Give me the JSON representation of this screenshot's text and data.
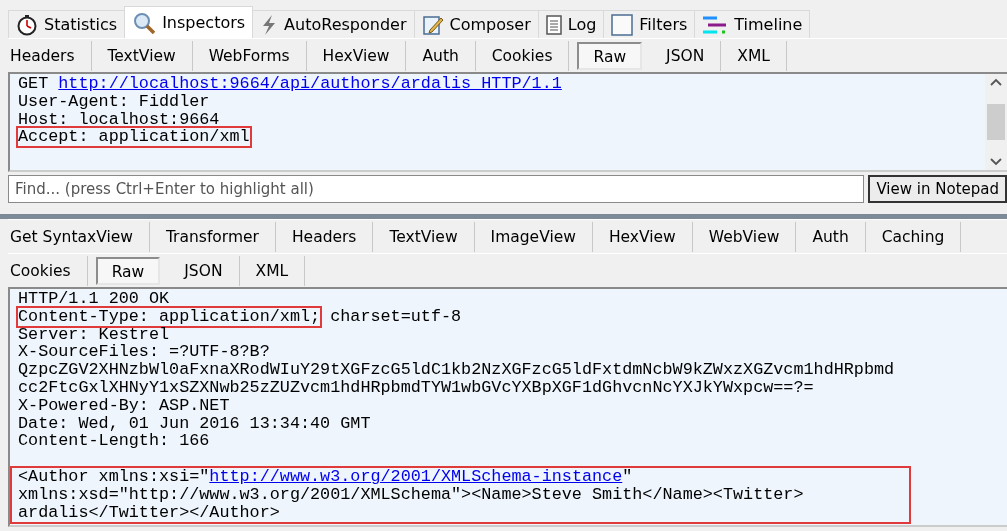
{
  "main_tabs": [
    {
      "label": "Statistics",
      "selected": false
    },
    {
      "label": "Inspectors",
      "selected": true
    },
    {
      "label": "AutoResponder",
      "selected": false
    },
    {
      "label": "Composer",
      "selected": false
    },
    {
      "label": "Log",
      "selected": false
    },
    {
      "label": "Filters",
      "selected": false
    },
    {
      "label": "Timeline",
      "selected": false
    }
  ],
  "request": {
    "tab_rows": [
      [
        {
          "label": "Headers",
          "selected": false
        },
        {
          "label": "TextView",
          "selected": false
        },
        {
          "label": "WebForms",
          "selected": false
        },
        {
          "label": "HexView",
          "selected": false
        },
        {
          "label": "Auth",
          "selected": false
        },
        {
          "label": "Cookies",
          "selected": false
        },
        {
          "label": "Raw",
          "selected": true
        },
        {
          "label": "JSON",
          "selected": false
        },
        {
          "label": "XML",
          "selected": false
        }
      ]
    ],
    "blocks": [
      {
        "boxed": false,
        "lines": [
          [
            {
              "text": "GET ",
              "link": false,
              "boxed": false
            },
            {
              "text": "http://localhost:9664/api/authors/ardalis HTTP/1.1",
              "link": true,
              "boxed": false
            }
          ],
          [
            {
              "text": "User-Agent: Fiddler",
              "link": false,
              "boxed": false
            }
          ],
          [
            {
              "text": "Host: localhost:9664",
              "link": false,
              "boxed": false
            }
          ],
          [
            {
              "text": "Accept: application/xml",
              "link": false,
              "boxed": true
            }
          ]
        ]
      }
    ],
    "find": {
      "placeholder": "Find... (press Ctrl+Enter to highlight all)"
    },
    "notepad_button": "View in Notepad"
  },
  "response": {
    "tab_rows": [
      [
        {
          "label": "Get SyntaxView",
          "selected": false
        },
        {
          "label": "Transformer",
          "selected": false
        },
        {
          "label": "Headers",
          "selected": false
        },
        {
          "label": "TextView",
          "selected": false
        },
        {
          "label": "ImageView",
          "selected": false
        },
        {
          "label": "HexView",
          "selected": false
        },
        {
          "label": "WebView",
          "selected": false
        },
        {
          "label": "Auth",
          "selected": false
        },
        {
          "label": "Caching",
          "selected": false
        }
      ],
      [
        {
          "label": "Cookies",
          "selected": false
        },
        {
          "label": "Raw",
          "selected": true
        },
        {
          "label": "JSON",
          "selected": false
        },
        {
          "label": "XML",
          "selected": false
        }
      ]
    ],
    "blocks": [
      {
        "boxed": false,
        "lines": [
          [
            {
              "text": "HTTP/1.1 200 OK",
              "link": false,
              "boxed": false
            }
          ],
          [
            {
              "text": "Content-Type: application/xml;",
              "link": false,
              "boxed": true
            },
            {
              "text": " charset=utf-8",
              "link": false,
              "boxed": false
            }
          ],
          [
            {
              "text": "Server: Kestrel",
              "link": false,
              "boxed": false
            }
          ],
          [
            {
              "text": "X-SourceFiles: =?UTF-8?B?",
              "link": false,
              "boxed": false
            }
          ],
          [
            {
              "text": "QzpcZGV2XHNzbWl0aFxnaXRodWIuY29tXGFzcG5ldC1kb2NzXGFzcG5ldFxtdmNcbW9kZWxzXGZvcm1hdHRpbmd",
              "link": false,
              "boxed": false
            }
          ],
          [
            {
              "text": "cc2FtcGxlXHNyY1xSZXNwb25zZUZvcm1hdHRpbmdTYW1wbGVcYXBpXGF1dGhvcnNcYXJkYWxpcw==?=",
              "link": false,
              "boxed": false
            }
          ],
          [
            {
              "text": "X-Powered-By: ASP.NET",
              "link": false,
              "boxed": false
            }
          ],
          [
            {
              "text": "Date: Wed, 01 Jun 2016 13:34:40 GMT",
              "link": false,
              "boxed": false
            }
          ],
          [
            {
              "text": "Content-Length: 166",
              "link": false,
              "boxed": false
            }
          ]
        ]
      },
      {
        "boxed": true,
        "lines": [
          [
            {
              "text": "<Author xmlns:xsi=\"",
              "link": false,
              "boxed": false
            },
            {
              "text": "http://www.w3.org/2001/XMLSchema-instance",
              "link": true,
              "boxed": false
            },
            {
              "text": "\"",
              "link": false,
              "boxed": false
            }
          ],
          [
            {
              "text": "xmlns:xsd=\"http://www.w3.org/2001/XMLSchema\"><Name>Steve Smith</Name><Twitter>",
              "link": false,
              "boxed": false
            }
          ],
          [
            {
              "text": "ardalis</Twitter></Author>",
              "link": false,
              "boxed": false
            }
          ]
        ]
      }
    ]
  }
}
